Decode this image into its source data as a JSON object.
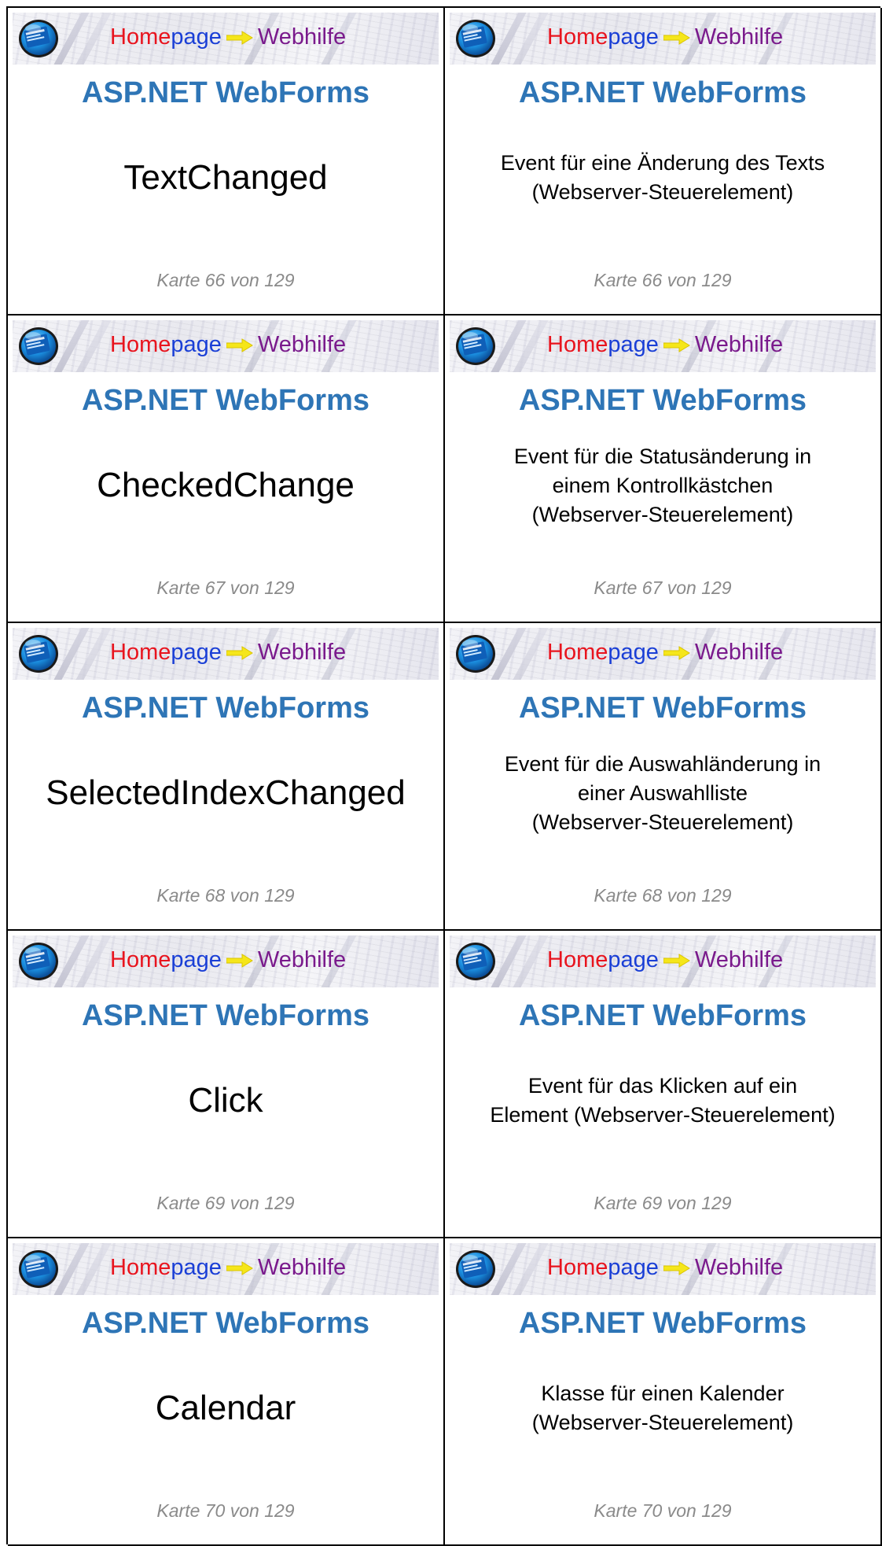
{
  "brand": {
    "home_part1": "Home",
    "home_part2": "page",
    "webhilfe": "Webhilfe"
  },
  "course_title": "ASP.NET WebForms",
  "cards": [
    {
      "front": "TextChanged",
      "back": "Event für eine Änderung des Texts\n(Webserver-Steuerelement)",
      "counter": "Karte 66 von 129"
    },
    {
      "front": "CheckedChange",
      "back": "Event für die Statusänderung in\neinem Kontrollkästchen\n(Webserver-Steuerelement)",
      "counter": "Karte 67 von 129"
    },
    {
      "front": "SelectedIndexChanged",
      "back": "Event für die Auswahländerung in\neiner Auswahlliste\n(Webserver-Steuerelement)",
      "counter": "Karte 68 von 129"
    },
    {
      "front": "Click",
      "back": "Event für das Klicken auf ein\nElement (Webserver-Steuerelement)",
      "counter": "Karte 69 von 129"
    },
    {
      "front": "Calendar",
      "back": "Klasse für einen Kalender\n(Webserver-Steuerelement)",
      "counter": "Karte 70 von 129"
    }
  ],
  "colors": {
    "course_title": "#2e75b6",
    "counter": "#8a8a8a",
    "home_red": "#e8141e",
    "home_blue": "#1a3fd6",
    "webhilfe_purple": "#7a1a8c",
    "arrow_yellow": "#f5e61a"
  },
  "icons": {
    "logo": "homepage-webhilfe-logo-icon",
    "arrow": "yellow-arrow-icon"
  }
}
